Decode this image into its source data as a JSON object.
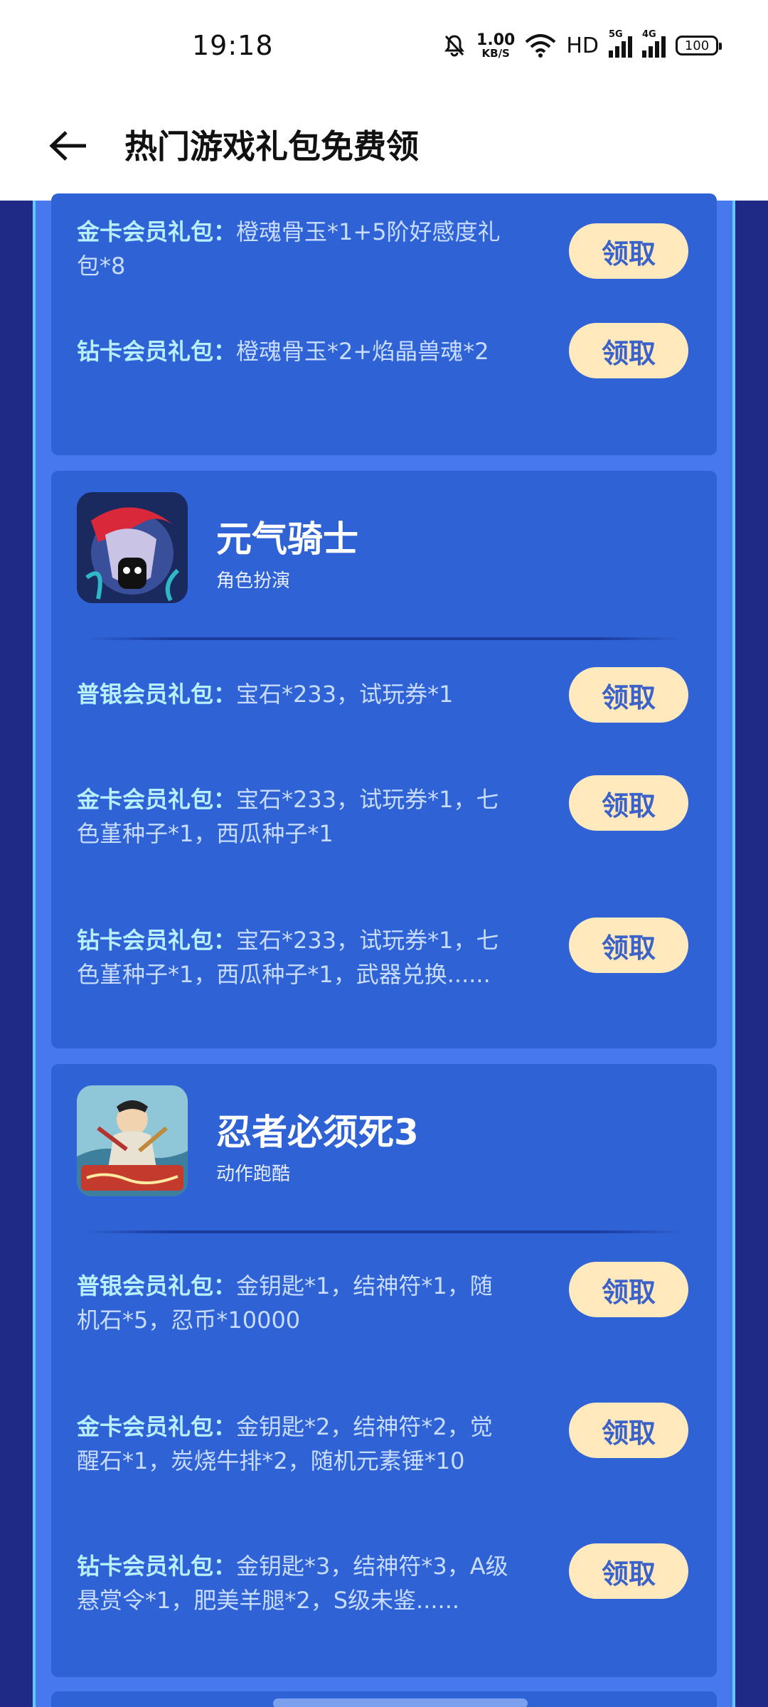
{
  "status_bar": {
    "time": "19:18",
    "speed_value": "1.00",
    "speed_unit": "KB/S",
    "hd_label": "HD",
    "net1_label": "5G",
    "net2_label": "4G",
    "battery": "100",
    "icons": [
      "bell-muted-icon",
      "wifi-icon",
      "signal-icon",
      "battery-icon"
    ]
  },
  "header": {
    "title": "热门游戏礼包免费领",
    "back_icon": "arrow-left-icon"
  },
  "claim_label": "领取",
  "card0": {
    "gifts": [
      {
        "type": "金卡会员礼包：",
        "content": "橙魂骨玉*1+5阶好感度礼包*8"
      },
      {
        "type": "钻卡会员礼包：",
        "content": "橙魂骨玉*2+焰晶兽魂*2"
      }
    ]
  },
  "card1": {
    "name": "元气骑士",
    "category": "角色扮演",
    "gifts": [
      {
        "type": "普银会员礼包：",
        "content": "宝石*233，试玩券*1"
      },
      {
        "type": "金卡会员礼包：",
        "content": "宝石*233，试玩券*1，七色堇种子*1，西瓜种子*1"
      },
      {
        "type": "钻卡会员礼包：",
        "content": "宝石*233，试玩券*1，七色堇种子*1，西瓜种子*1，武器兑换......"
      }
    ]
  },
  "card2": {
    "name": "忍者必须死3",
    "category": "动作跑酷",
    "icon_lettering": "忍者必须死3礼包",
    "gifts": [
      {
        "type": "普银会员礼包：",
        "content": "金钥匙*1，结神符*1，随机石*5，忍币*10000"
      },
      {
        "type": "金卡会员礼包：",
        "content": "金钥匙*2，结神符*2，觉醒石*1，炭烧牛排*2，随机元素锤*10"
      },
      {
        "type": "钻卡会员礼包：",
        "content": "金钥匙*3，结神符*3，A级悬赏令*1，肥美羊腿*2，S级未鉴......"
      }
    ]
  },
  "colors": {
    "background": "#1e2a86",
    "panel": "#4878ee",
    "card": "#2f62d4",
    "claim_button": "#ffe9bd",
    "claim_text": "#3b62c9"
  }
}
